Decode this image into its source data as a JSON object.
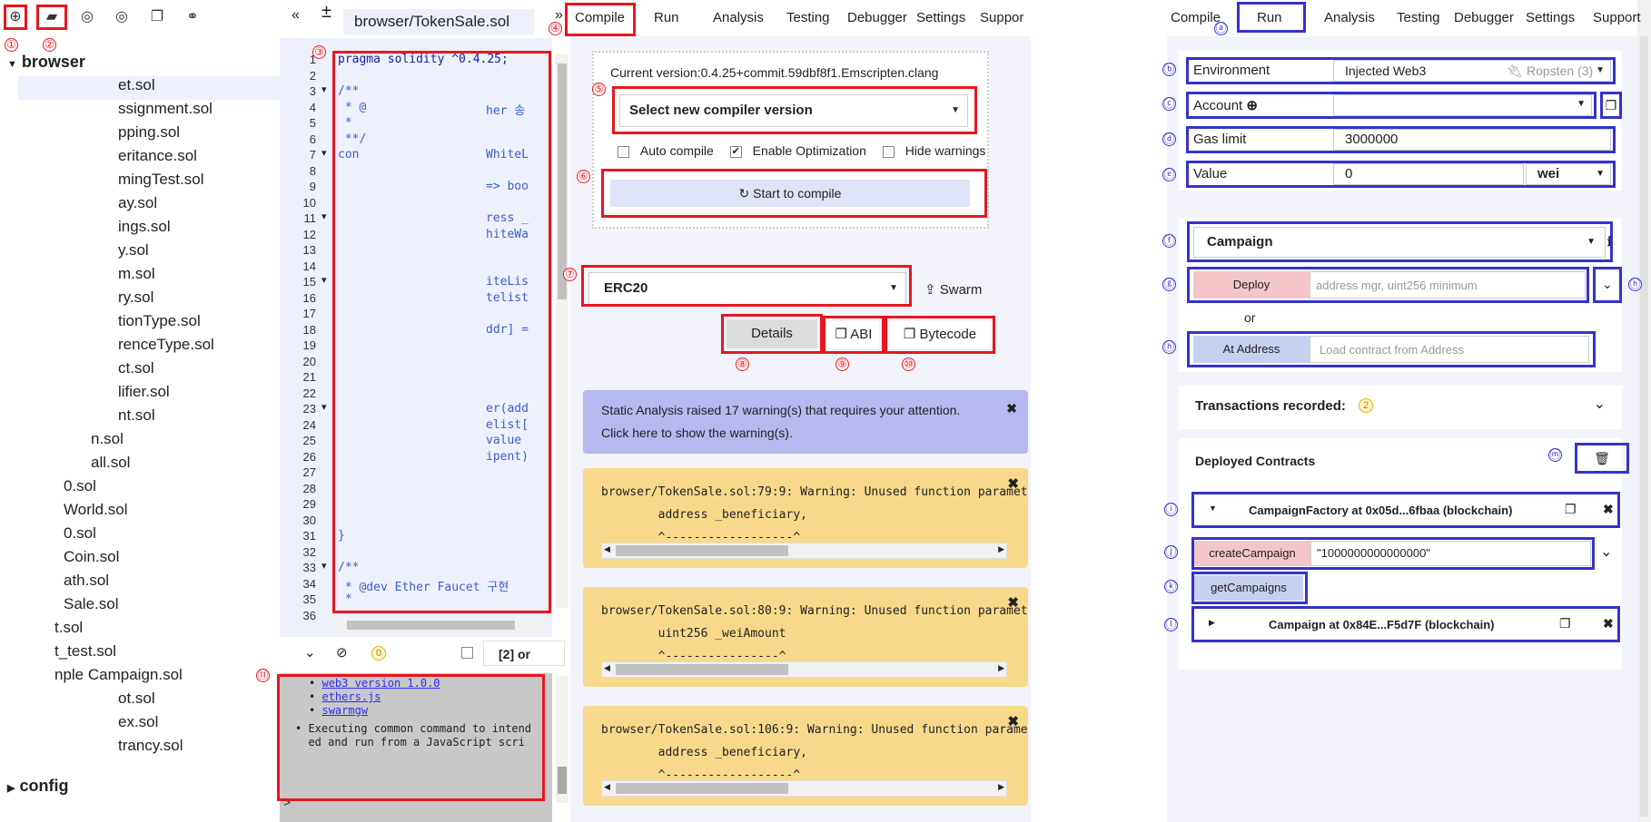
{
  "file_explorer": {
    "toolbar_icons": [
      "plus-circle-icon",
      "folder-open-icon",
      "github-icon",
      "github-icon",
      "copy-icon",
      "link-icon"
    ],
    "root_folder": "browser",
    "files": [
      "et.sol",
      "ssignment.sol",
      "pping.sol",
      "eritance.sol",
      "mingTest.sol",
      "ay.sol",
      "ings.sol",
      "y.sol",
      "m.sol",
      "ry.sol",
      "tionType.sol",
      "renceType.sol",
      "ct.sol",
      "lifier.sol",
      "nt.sol",
      "n.sol",
      "all.sol",
      "0.sol",
      "World.sol",
      "0.sol",
      "Coin.sol",
      "ath.sol",
      "Sale.sol",
      "t.sol",
      "t_test.sol",
      "nple  Campaign.sol",
      "ot.sol",
      "ex.sol",
      "trancy.sol"
    ],
    "config_folder": "config"
  },
  "editor": {
    "tab_title": "browser/TokenSale.sol",
    "line_numbers": [
      "1",
      "2",
      "3",
      "4",
      "5",
      "6",
      "7",
      "8",
      "9",
      "10",
      "11",
      "12",
      "13",
      "14",
      "15",
      "16",
      "17",
      "18",
      "19",
      "20",
      "21",
      "22",
      "23",
      "24",
      "25",
      "26",
      "27",
      "28",
      "29",
      "30",
      "31",
      "32",
      "33",
      "34",
      "35",
      "36"
    ],
    "code_lines_left": {
      "l1": "pragma solidity ^0.4.25;",
      "l3": "/**",
      "l4": " * @",
      "l5": " *",
      "l6": " **/",
      "l7": "con",
      "l31": "}",
      "l33": "/**",
      "l34": " * @dev Ether Faucet 구현",
      "l35": " *"
    },
    "code_lines_right": {
      "l4": "her 송",
      "l7": "WhiteL",
      "l9": "=> boo",
      "l11": "ress _",
      "l12": "hiteWa",
      "l15": "iteLis",
      "l16": "telist",
      "l18": "ddr] =",
      "l23": "er(add",
      "l24": "elist[",
      "l25": "value",
      "l26": "ipent)"
    }
  },
  "terminal": {
    "badge_count": "0",
    "filter_label": "[2] or",
    "links": [
      "web3 version 1.0.0",
      "ethers.js",
      "swarmgw"
    ],
    "message": "Executing common command to interact and run from a JavaScript scri",
    "message_line1": "Executing common command to intend",
    "message_line2": "ed and run from a JavaScript scri",
    "prompt": ">"
  },
  "compile_panel": {
    "tabs": [
      "Compile",
      "Run",
      "Analysis",
      "Testing",
      "Debugger",
      "Settings",
      "Suppor"
    ],
    "current_version_label": "Current version:0.4.25+commit.59dbf8f1.Emscripten.clang",
    "compiler_select": "Select new compiler version",
    "options": [
      {
        "label": "Auto compile",
        "checked": false
      },
      {
        "label": "Enable Optimization",
        "checked": true
      },
      {
        "label": "Hide warnings",
        "checked": false
      }
    ],
    "compile_button": "Start to compile",
    "contract_select": "ERC20",
    "swarm_label": "Swarm",
    "details_button": "Details",
    "abi_button": "ABI",
    "bytecode_button": "Bytecode",
    "static_analysis": {
      "line1": "Static Analysis raised 17 warning(s) that requires your attention.",
      "line2": "Click here to show the warning(s)."
    },
    "warnings": [
      {
        "location": "browser/TokenSale.sol:79:9: Warning: Unused function paramet",
        "detail": "        address _beneficiary,",
        "marker": "        ^------------------^"
      },
      {
        "location": "browser/TokenSale.sol:80:9: Warning: Unused function paramet",
        "detail": "        uint256 _weiAmount",
        "marker": "        ^----------------^"
      },
      {
        "location": "browser/TokenSale.sol:106:9: Warning: Unused function parame",
        "detail": "        address _beneficiary,",
        "marker": "        ^------------------^"
      }
    ]
  },
  "run_panel": {
    "tabs": [
      "Compile",
      "Run",
      "Analysis",
      "Testing",
      "Debugger",
      "Settings",
      "Support"
    ],
    "environment_label": "Environment",
    "environment_value": "Injected Web3",
    "network": "Ropsten (3)",
    "account_label": "Account",
    "gas_limit_label": "Gas limit",
    "gas_limit_value": "3000000",
    "value_label": "Value",
    "value_amount": "0",
    "value_unit": "wei",
    "contract_select": "Campaign",
    "deploy_button": "Deploy",
    "deploy_placeholder": "address mgr, uint256 minimum",
    "or_label": "or",
    "at_address_button": "At Address",
    "at_address_placeholder": "Load contract from Address",
    "transactions_label": "Transactions recorded:",
    "transactions_count": "2",
    "deployed_label": "Deployed Contracts",
    "deployed": [
      {
        "title": "CampaignFactory at 0x05d...6fbaa (blockchain)"
      },
      {
        "title": "Campaign at 0x84E...F5d7F (blockchain)"
      }
    ],
    "create_campaign_button": "createCampaign",
    "create_campaign_value": "\"1000000000000000\"",
    "get_campaigns_button": "getCampaigns"
  },
  "annotations": {
    "red": [
      "①",
      "②",
      "③",
      "④",
      "⑤",
      "⑥",
      "⑦",
      "⑧",
      "⑨",
      "⑩",
      "⑪"
    ],
    "blue": [
      "ⓐ",
      "ⓑ",
      "ⓒ",
      "ⓓ",
      "ⓔ",
      "ⓕ",
      "ⓖ",
      "ⓗ",
      "ⓗ",
      "ⓘ",
      "ⓙ",
      "ⓚ",
      "ⓛ",
      "ⓜ"
    ]
  },
  "colors": {
    "annotation_red": "#e8161f",
    "annotation_blue": "#3333cc",
    "warning_bg": "#f8d98b",
    "analysis_bg": "#b7b8ef"
  }
}
